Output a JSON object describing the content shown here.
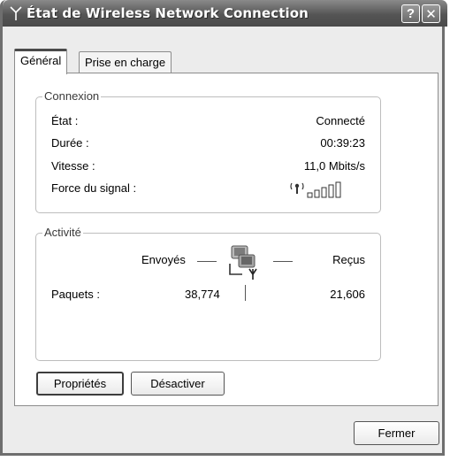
{
  "window": {
    "title": "État de Wireless Network Connection",
    "help_label": "?",
    "close_label": "✕"
  },
  "tabs": [
    {
      "label": "Général",
      "active": true
    },
    {
      "label": "Prise en charge",
      "active": false
    }
  ],
  "connection": {
    "group_label": "Connexion",
    "rows": [
      {
        "label": "État :",
        "value": "Connecté"
      },
      {
        "label": "Durée :",
        "value": "00:39:23"
      },
      {
        "label": "Vitesse :",
        "value": "11,0 Mbits/s"
      },
      {
        "label": "Force du signal :",
        "value": ""
      }
    ],
    "signal_bars_filled": 3,
    "signal_bars_total": 5
  },
  "activity": {
    "group_label": "Activité",
    "sent_label": "Envoyés",
    "received_label": "Reçus",
    "packets_label": "Paquets :",
    "packets_sent": "38,774",
    "packets_received": "21,606"
  },
  "buttons": {
    "properties": "Propriétés",
    "disable": "Désactiver",
    "close": "Fermer"
  }
}
